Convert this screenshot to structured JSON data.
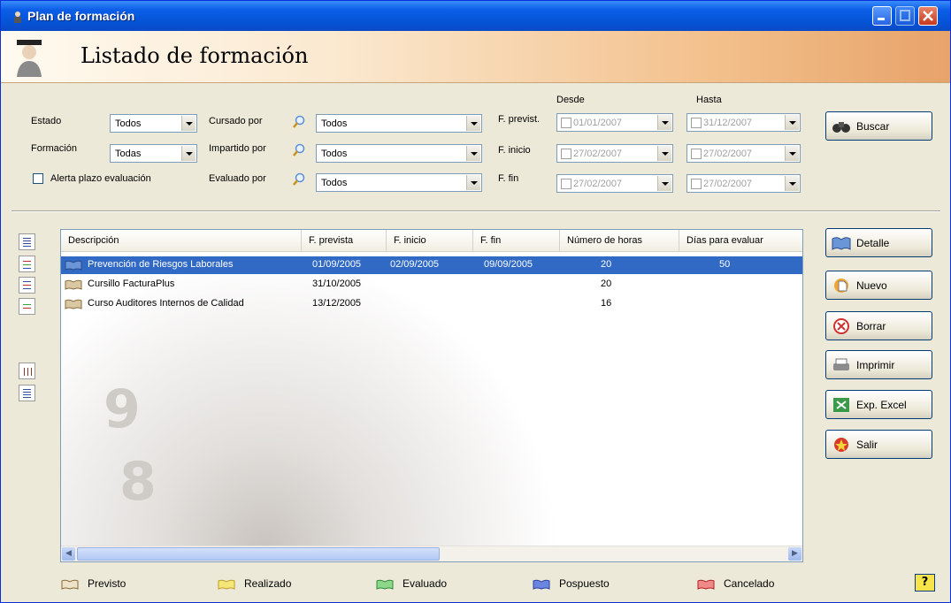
{
  "window": {
    "title": "Plan de formación"
  },
  "header": {
    "title": "Listado de formación"
  },
  "filters": {
    "estado_label": "Estado",
    "estado_value": "Todos",
    "formacion_label": "Formación",
    "formacion_value": "Todas",
    "alerta_label": "Alerta plazo evaluación",
    "cursado_label": "Cursado por",
    "cursado_value": "Todos",
    "impartido_label": "Impartido por",
    "impartido_value": "Todos",
    "evaluado_label": "Evaluado por",
    "evaluado_value": "Todos",
    "desde_label": "Desde",
    "hasta_label": "Hasta",
    "fprevist_label": "F. previst.",
    "finicio_label": "F. inicio",
    "ffin_label": "F. fin",
    "fprevist_desde": "01/01/2007",
    "fprevist_hasta": "31/12/2007",
    "finicio_desde": "27/02/2007",
    "finicio_hasta": "27/02/2007",
    "ffin_desde": "27/02/2007",
    "ffin_hasta": "27/02/2007"
  },
  "buttons": {
    "buscar": "Buscar",
    "detalle": "Detalle",
    "nuevo": "Nuevo",
    "borrar": "Borrar",
    "imprimir": "Imprimir",
    "exp_excel": "Exp. Excel",
    "salir": "Salir",
    "help": "?"
  },
  "table": {
    "columns": [
      "Descripción",
      "F. prevista",
      "F. inicio",
      "F. fin",
      "Número de horas",
      "Días para evaluar"
    ],
    "rows": [
      {
        "descripcion": "Prevención de Riesgos Laborales",
        "f_prevista": "01/09/2005",
        "f_inicio": "02/09/2005",
        "f_fin": "09/09/2005",
        "horas": "20",
        "dias": "50",
        "selected": true
      },
      {
        "descripcion": "Cursillo FacturaPlus",
        "f_prevista": "31/10/2005",
        "f_inicio": "",
        "f_fin": "",
        "horas": "20",
        "dias": "",
        "selected": false
      },
      {
        "descripcion": "Curso Auditores Internos de Calidad",
        "f_prevista": "13/12/2005",
        "f_inicio": "",
        "f_fin": "",
        "horas": "16",
        "dias": "",
        "selected": false
      }
    ]
  },
  "legend": [
    {
      "label": "Previsto",
      "color": "#8a6a3a"
    },
    {
      "label": "Realizado",
      "color": "#e8d040"
    },
    {
      "label": "Evaluado",
      "color": "#3aa040"
    },
    {
      "label": "Pospuesto",
      "color": "#3050c0"
    },
    {
      "label": "Cancelado",
      "color": "#c03030"
    }
  ]
}
